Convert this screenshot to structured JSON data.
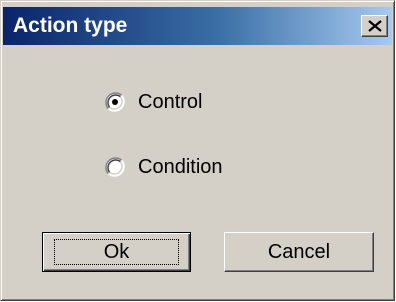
{
  "dialog": {
    "title": "Action type",
    "close_icon": "close-x-icon"
  },
  "options": {
    "control_label": "Control",
    "control_selected": true,
    "condition_label": "Condition",
    "condition_selected": false
  },
  "buttons": {
    "ok_label": "Ok",
    "cancel_label": "Cancel"
  },
  "colors": {
    "title_start": "#0a246a",
    "title_end": "#a6caf0",
    "face": "#d4d0c8"
  }
}
